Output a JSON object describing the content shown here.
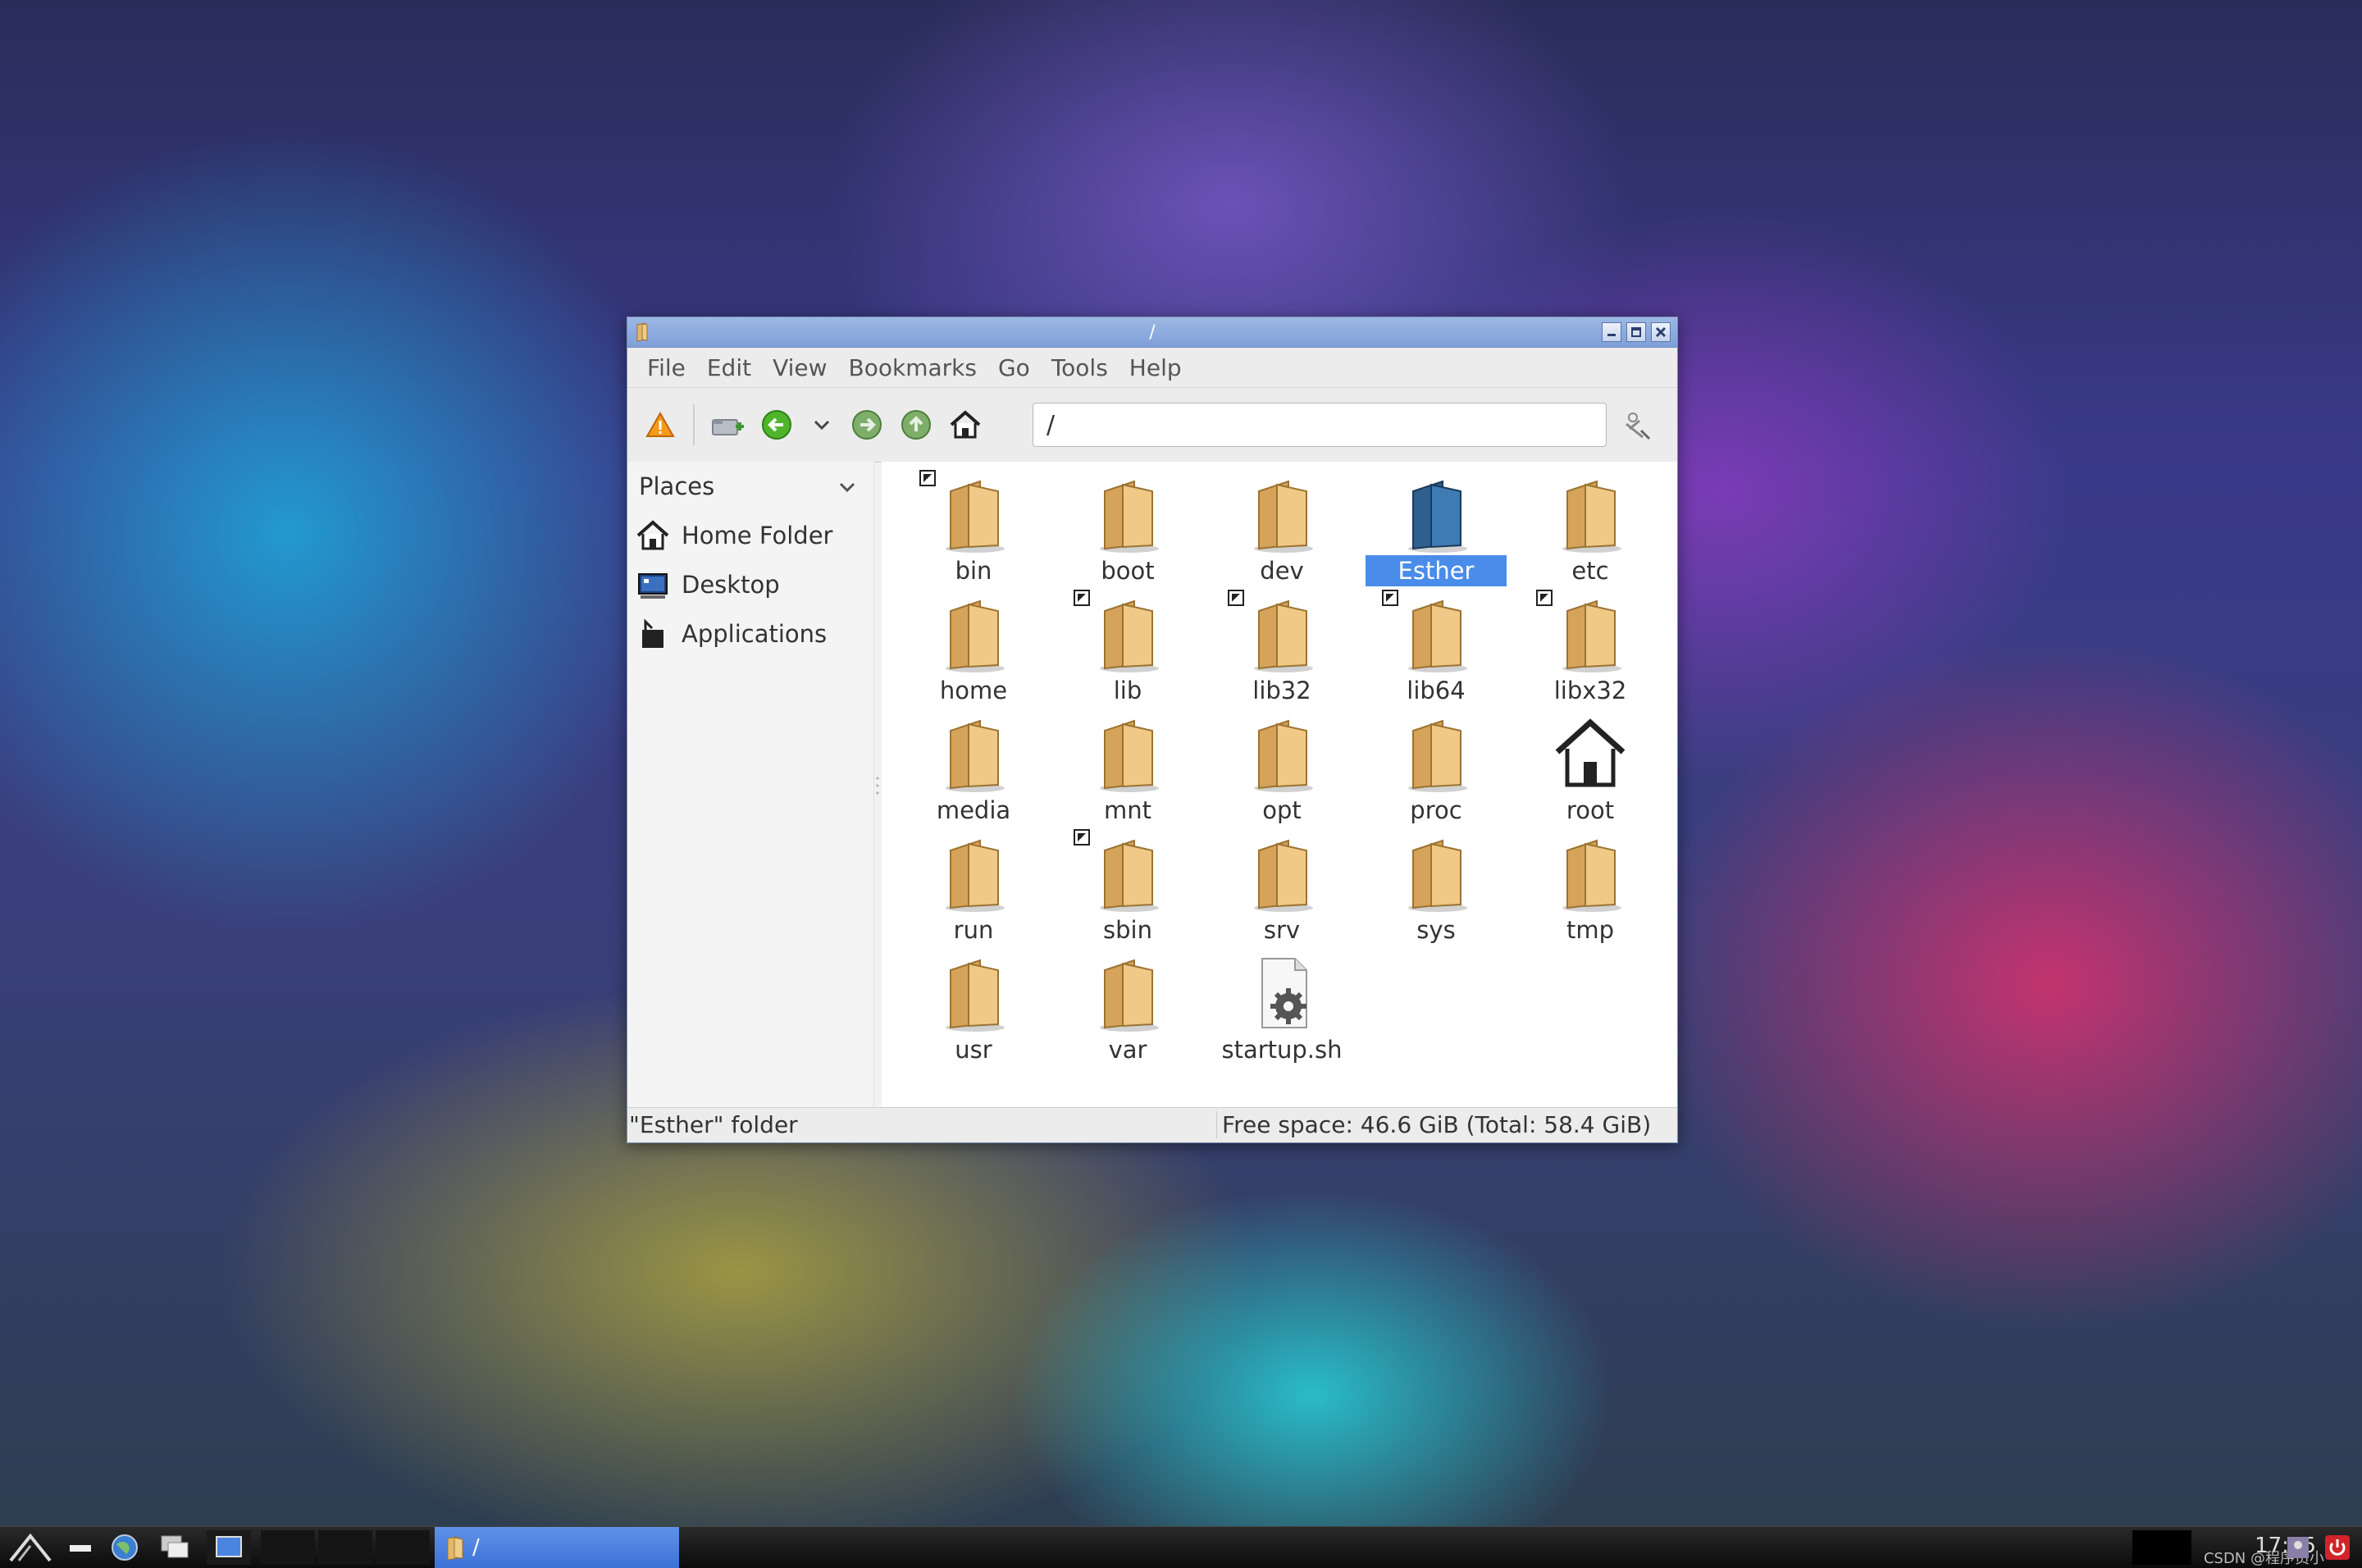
{
  "window": {
    "title": "/",
    "controls": {
      "minimize": "minimize",
      "maximize": "maximize",
      "close": "close"
    }
  },
  "menubar": [
    "File",
    "Edit",
    "View",
    "Bookmarks",
    "Go",
    "Tools",
    "Help"
  ],
  "toolbar": {
    "path_value": "/",
    "icons": [
      "warning-icon",
      "new-tab-icon",
      "back-icon",
      "history-dropdown-icon",
      "forward-icon",
      "up-icon",
      "home-icon",
      "clear-path-icon"
    ]
  },
  "sidebar": {
    "header": "Places",
    "items": [
      {
        "label": "Home Folder",
        "icon": "home-icon"
      },
      {
        "label": "Desktop",
        "icon": "desktop-icon"
      },
      {
        "label": "Applications",
        "icon": "applications-icon"
      }
    ]
  },
  "files": [
    {
      "name": "bin",
      "type": "folder",
      "symlink": true
    },
    {
      "name": "boot",
      "type": "folder",
      "symlink": false
    },
    {
      "name": "dev",
      "type": "folder",
      "symlink": false
    },
    {
      "name": "Esther",
      "type": "folder-blue",
      "symlink": false,
      "selected": true
    },
    {
      "name": "etc",
      "type": "folder",
      "symlink": false
    },
    {
      "name": "home",
      "type": "folder",
      "symlink": false
    },
    {
      "name": "lib",
      "type": "folder",
      "symlink": true
    },
    {
      "name": "lib32",
      "type": "folder",
      "symlink": true
    },
    {
      "name": "lib64",
      "type": "folder",
      "symlink": true
    },
    {
      "name": "libx32",
      "type": "folder",
      "symlink": true
    },
    {
      "name": "media",
      "type": "folder",
      "symlink": false
    },
    {
      "name": "mnt",
      "type": "folder",
      "symlink": false
    },
    {
      "name": "opt",
      "type": "folder",
      "symlink": false
    },
    {
      "name": "proc",
      "type": "folder",
      "symlink": false
    },
    {
      "name": "root",
      "type": "home",
      "symlink": false
    },
    {
      "name": "run",
      "type": "folder",
      "symlink": false
    },
    {
      "name": "sbin",
      "type": "folder",
      "symlink": true
    },
    {
      "name": "srv",
      "type": "folder",
      "symlink": false
    },
    {
      "name": "sys",
      "type": "folder",
      "symlink": false
    },
    {
      "name": "tmp",
      "type": "folder",
      "symlink": false
    },
    {
      "name": "usr",
      "type": "folder",
      "symlink": false
    },
    {
      "name": "var",
      "type": "folder",
      "symlink": false
    },
    {
      "name": "startup.sh",
      "type": "script",
      "symlink": false
    }
  ],
  "statusbar": {
    "left": "\"Esther\" folder",
    "right": "Free space: 46.6 GiB (Total: 58.4 GiB)"
  },
  "taskbar": {
    "task_label": "/",
    "clock": "17:55",
    "watermark": "CSDN @程序员小"
  },
  "colors": {
    "selection": "#4a8cea",
    "titlebar": "#8aaae0",
    "folder": "#e0b56a"
  }
}
